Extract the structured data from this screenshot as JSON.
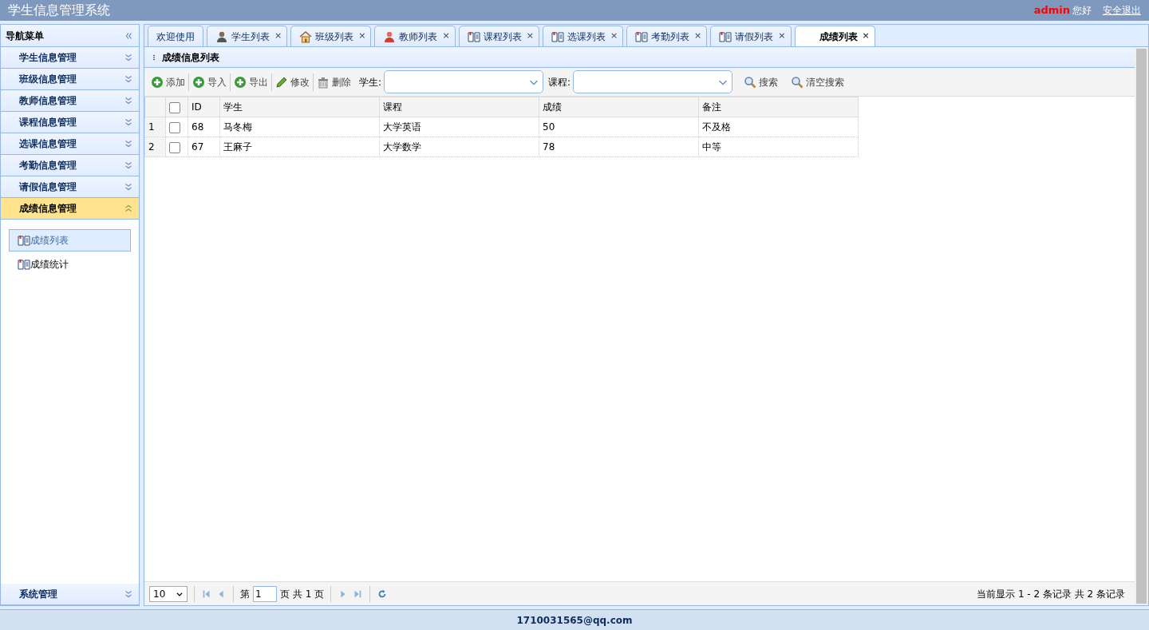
{
  "header": {
    "title": "学生信息管理系统",
    "user": "admin",
    "greeting": "您好",
    "logout": "安全退出"
  },
  "nav": {
    "title": "导航菜单",
    "sections": [
      {
        "label": "学生信息管理",
        "expanded": false
      },
      {
        "label": "班级信息管理",
        "expanded": false
      },
      {
        "label": "教师信息管理",
        "expanded": false
      },
      {
        "label": "课程信息管理",
        "expanded": false
      },
      {
        "label": "选课信息管理",
        "expanded": false
      },
      {
        "label": "考勤信息管理",
        "expanded": false
      },
      {
        "label": "请假信息管理",
        "expanded": false
      },
      {
        "label": "成绩信息管理",
        "expanded": true,
        "items": [
          {
            "label": "成绩列表",
            "selected": true
          },
          {
            "label": "成绩统计",
            "selected": false
          }
        ]
      },
      {
        "label": "系统管理",
        "expanded": false
      }
    ]
  },
  "tabs": [
    {
      "label": "欢迎使用",
      "kind": "plain",
      "selected": false
    },
    {
      "label": "学生列表",
      "kind": "person",
      "close": "×",
      "selected": false
    },
    {
      "label": "班级列表",
      "kind": "house",
      "close": "×",
      "selected": false
    },
    {
      "label": "教师列表",
      "kind": "teacher",
      "close": "×",
      "selected": false
    },
    {
      "label": "课程列表",
      "kind": "book",
      "close": "×",
      "selected": false
    },
    {
      "label": "选课列表",
      "kind": "book",
      "close": "×",
      "selected": false
    },
    {
      "label": "考勤列表",
      "kind": "book",
      "close": "×",
      "selected": false
    },
    {
      "label": "请假列表",
      "kind": "book",
      "close": "×",
      "selected": false
    },
    {
      "label": "成绩列表",
      "kind": "blank",
      "close": "×",
      "selected": true
    }
  ],
  "panel_title": "成绩信息列表",
  "toolbar": [
    {
      "label": "添加",
      "kind": "add"
    },
    {
      "label": "导入",
      "kind": "add"
    },
    {
      "label": "导出",
      "kind": "add"
    },
    {
      "label": "修改",
      "kind": "edit"
    },
    {
      "label": "删除",
      "kind": "delete"
    }
  ],
  "filters": [
    {
      "label": "学生:"
    },
    {
      "label": "课程:"
    }
  ],
  "search_buttons": [
    "搜索",
    "清空搜索"
  ],
  "table": {
    "select_all_checked": false,
    "columns": [
      "ID",
      "学生",
      "课程",
      "成绩",
      "备注"
    ],
    "rows": [
      {
        "number": "1",
        "checked": false,
        "cells": [
          "68",
          "马冬梅",
          "大学英语",
          "50",
          "不及格"
        ]
      },
      {
        "number": "2",
        "checked": false,
        "cells": [
          "67",
          "王麻子",
          "大学数学",
          "78",
          "中等"
        ]
      }
    ]
  },
  "pager": {
    "page_size": "10",
    "before": "第",
    "page": "1",
    "after": "页 共 1 页",
    "info": "当前显示 1 - 2 条记录 共 2 条记录"
  },
  "footer": "1710031565@qq.com"
}
